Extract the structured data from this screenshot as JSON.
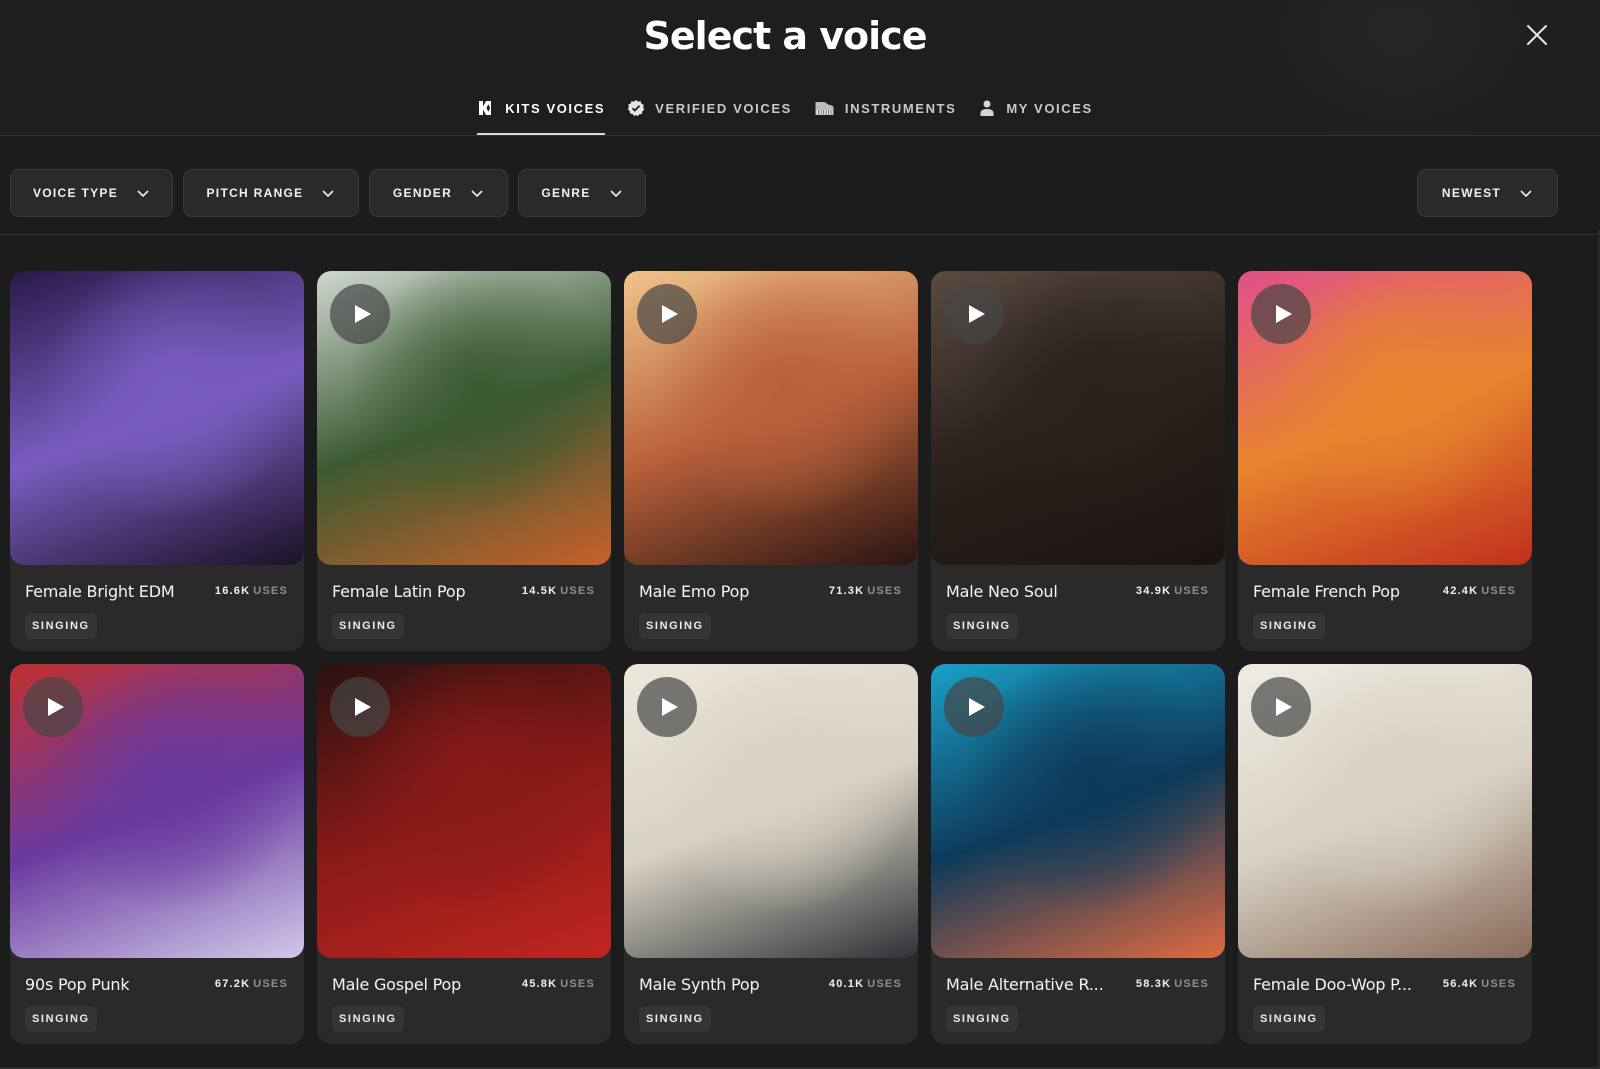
{
  "header": {
    "title": "Select a voice",
    "close_icon": "close-icon"
  },
  "tabs": [
    {
      "label": "KITS VOICES",
      "icon": "kits-logo-icon",
      "active": true
    },
    {
      "label": "VERIFIED VOICES",
      "icon": "verified-badge-icon",
      "active": false
    },
    {
      "label": "INSTRUMENTS",
      "icon": "piano-icon",
      "active": false
    },
    {
      "label": "MY VOICES",
      "icon": "user-icon",
      "active": false
    }
  ],
  "filters": [
    {
      "label": "VOICE TYPE",
      "icon": "chevron-down-icon"
    },
    {
      "label": "PITCH RANGE",
      "icon": "chevron-down-icon"
    },
    {
      "label": "GENDER",
      "icon": "chevron-down-icon"
    },
    {
      "label": "GENRE",
      "icon": "chevron-down-icon"
    }
  ],
  "sort": {
    "label": "NEWEST",
    "icon": "chevron-down-icon"
  },
  "uses_suffix": "USES",
  "voices": [
    {
      "name": "Female Bright EDM",
      "uses": "16.6K",
      "tag": "SINGING",
      "play_visible": false,
      "colors": [
        "#2a1a4a",
        "#7a5cc0",
        "#1a1226"
      ]
    },
    {
      "name": "Female Latin Pop",
      "uses": "14.5K",
      "tag": "SINGING",
      "play_visible": true,
      "colors": [
        "#cfd8d0",
        "#3b5a32",
        "#c8602a"
      ]
    },
    {
      "name": "Male Emo Pop",
      "uses": "71.3K",
      "tag": "SINGING",
      "play_visible": true,
      "colors": [
        "#f0c48a",
        "#b9603a",
        "#2a1512"
      ]
    },
    {
      "name": "Male Neo Soul",
      "uses": "34.9K",
      "tag": "SINGING",
      "play_visible": true,
      "colors": [
        "#5a4a40",
        "#2b211d",
        "#1a1411"
      ]
    },
    {
      "name": "Female French Pop",
      "uses": "42.4K",
      "tag": "SINGING",
      "play_visible": true,
      "colors": [
        "#e0508a",
        "#e8842e",
        "#c0301e"
      ]
    },
    {
      "name": "90s Pop Punk",
      "uses": "67.2K",
      "tag": "SINGING",
      "play_visible": true,
      "colors": [
        "#c03030",
        "#6a3aa0",
        "#d0c8e8"
      ]
    },
    {
      "name": "Male Gospel Pop",
      "uses": "45.8K",
      "tag": "SINGING",
      "play_visible": true,
      "colors": [
        "#2a1210",
        "#8a1a18",
        "#c02620"
      ]
    },
    {
      "name": "Male Synth Pop",
      "uses": "40.1K",
      "tag": "SINGING",
      "play_visible": true,
      "colors": [
        "#ece8dc",
        "#d8d2c2",
        "#2e3238"
      ]
    },
    {
      "name": "Male Alternative R...",
      "uses": "58.3K",
      "tag": "SINGING",
      "play_visible": true,
      "colors": [
        "#1aa0c8",
        "#0e3a5a",
        "#e06a40"
      ]
    },
    {
      "name": "Female Doo-Wop P...",
      "uses": "56.4K",
      "tag": "SINGING",
      "play_visible": true,
      "colors": [
        "#efece2",
        "#d8d2c4",
        "#8a6a5a"
      ]
    }
  ]
}
